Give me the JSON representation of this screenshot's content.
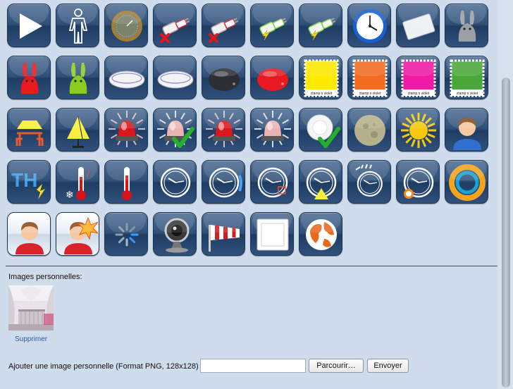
{
  "icons": [
    {
      "name": "play-icon"
    },
    {
      "name": "person-outline-icon"
    },
    {
      "name": "gauge-icon"
    },
    {
      "name": "plug-off-icon"
    },
    {
      "name": "plug-off-2-icon"
    },
    {
      "name": "plug-on-icon"
    },
    {
      "name": "plug-on-2-icon"
    },
    {
      "name": "clock-icon"
    },
    {
      "name": "wall-switch-icon"
    },
    {
      "name": "rabbit-grey-icon"
    },
    {
      "name": "rabbit-red-icon"
    },
    {
      "name": "rabbit-green-icon"
    },
    {
      "name": "ceiling-light-icon"
    },
    {
      "name": "ceiling-light-2-icon"
    },
    {
      "name": "pebble-black-icon"
    },
    {
      "name": "pebble-red-icon"
    },
    {
      "name": "stamp-yellow-icon"
    },
    {
      "name": "stamp-orange-icon"
    },
    {
      "name": "stamp-magenta-icon"
    },
    {
      "name": "stamp-green-icon"
    },
    {
      "name": "table-lamp-icon"
    },
    {
      "name": "floor-lamp-icon"
    },
    {
      "name": "siren-red-icon"
    },
    {
      "name": "siren-ok-icon"
    },
    {
      "name": "siren-red-2-icon"
    },
    {
      "name": "siren-light-icon"
    },
    {
      "name": "smoke-detector-ok-icon"
    },
    {
      "name": "moon-icon"
    },
    {
      "name": "sun-icon"
    },
    {
      "name": "user-icon"
    },
    {
      "name": "temperature-humidity-icon"
    },
    {
      "name": "thermometer-cold-icon"
    },
    {
      "name": "thermometer-icon"
    },
    {
      "name": "timer-icon"
    },
    {
      "name": "timer-dim-icon"
    },
    {
      "name": "timer-box-icon"
    },
    {
      "name": "timer-light-icon"
    },
    {
      "name": "timer-signal-icon"
    },
    {
      "name": "timer-alarm-icon"
    },
    {
      "name": "ring-icon"
    },
    {
      "name": "user-selected-icon"
    },
    {
      "name": "user-alert-icon"
    },
    {
      "name": "loading-spinner-icon"
    },
    {
      "name": "webcam-icon"
    },
    {
      "name": "windsock-icon"
    },
    {
      "name": "white-square-icon"
    },
    {
      "name": "globe-icon"
    }
  ],
  "selected_index": 40,
  "alert_index": 41,
  "stamp_text": "ztamp:s  violet",
  "colors": {
    "rabbit_red": "#e8191f",
    "rabbit_green": "#8ccc22",
    "stamp_yellow": "#ffea00",
    "stamp_orange": "#f26b1f",
    "stamp_magenta": "#f01aa6",
    "stamp_green": "#4aa83a",
    "siren_red": "#d9181c",
    "check_green": "#25b02b",
    "sun": "#f6c90e",
    "ring_orange": "#f3a31c",
    "ring_blue": "#18a3d6",
    "link": "#2c5d9b"
  },
  "custom_section": {
    "title": "Images personnelles:",
    "delete_label": "Supprimer",
    "upload_label": "Ajouter une image personnelle (Format PNG, 128x128)",
    "file_value": "",
    "browse_label": "Parcourir…",
    "send_label": "Envoyer"
  }
}
